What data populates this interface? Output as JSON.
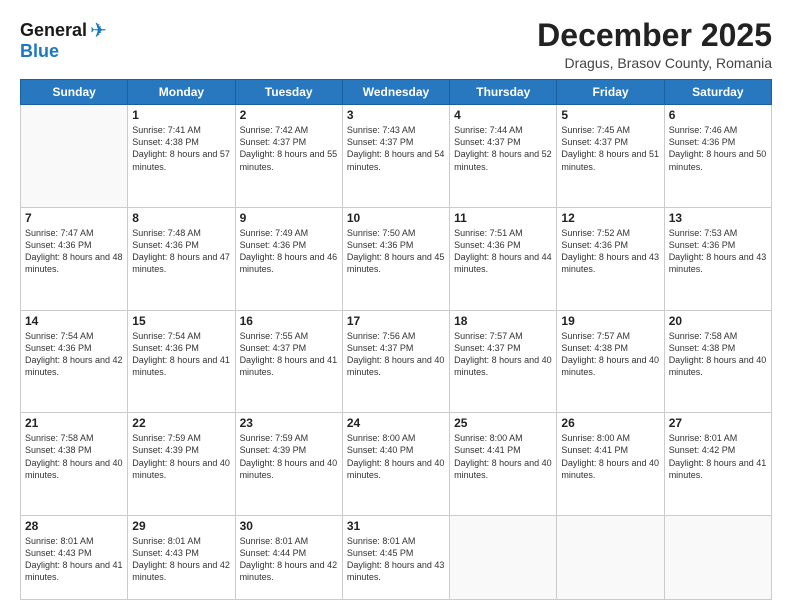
{
  "logo": {
    "line1": "General",
    "line2": "Blue"
  },
  "header": {
    "month": "December 2025",
    "location": "Dragus, Brasov County, Romania"
  },
  "weekdays": [
    "Sunday",
    "Monday",
    "Tuesday",
    "Wednesday",
    "Thursday",
    "Friday",
    "Saturday"
  ],
  "weeks": [
    [
      {
        "day": "",
        "sunrise": "",
        "sunset": "",
        "daylight": ""
      },
      {
        "day": "1",
        "sunrise": "Sunrise: 7:41 AM",
        "sunset": "Sunset: 4:38 PM",
        "daylight": "Daylight: 8 hours and 57 minutes."
      },
      {
        "day": "2",
        "sunrise": "Sunrise: 7:42 AM",
        "sunset": "Sunset: 4:37 PM",
        "daylight": "Daylight: 8 hours and 55 minutes."
      },
      {
        "day": "3",
        "sunrise": "Sunrise: 7:43 AM",
        "sunset": "Sunset: 4:37 PM",
        "daylight": "Daylight: 8 hours and 54 minutes."
      },
      {
        "day": "4",
        "sunrise": "Sunrise: 7:44 AM",
        "sunset": "Sunset: 4:37 PM",
        "daylight": "Daylight: 8 hours and 52 minutes."
      },
      {
        "day": "5",
        "sunrise": "Sunrise: 7:45 AM",
        "sunset": "Sunset: 4:37 PM",
        "daylight": "Daylight: 8 hours and 51 minutes."
      },
      {
        "day": "6",
        "sunrise": "Sunrise: 7:46 AM",
        "sunset": "Sunset: 4:36 PM",
        "daylight": "Daylight: 8 hours and 50 minutes."
      }
    ],
    [
      {
        "day": "7",
        "sunrise": "Sunrise: 7:47 AM",
        "sunset": "Sunset: 4:36 PM",
        "daylight": "Daylight: 8 hours and 48 minutes."
      },
      {
        "day": "8",
        "sunrise": "Sunrise: 7:48 AM",
        "sunset": "Sunset: 4:36 PM",
        "daylight": "Daylight: 8 hours and 47 minutes."
      },
      {
        "day": "9",
        "sunrise": "Sunrise: 7:49 AM",
        "sunset": "Sunset: 4:36 PM",
        "daylight": "Daylight: 8 hours and 46 minutes."
      },
      {
        "day": "10",
        "sunrise": "Sunrise: 7:50 AM",
        "sunset": "Sunset: 4:36 PM",
        "daylight": "Daylight: 8 hours and 45 minutes."
      },
      {
        "day": "11",
        "sunrise": "Sunrise: 7:51 AM",
        "sunset": "Sunset: 4:36 PM",
        "daylight": "Daylight: 8 hours and 44 minutes."
      },
      {
        "day": "12",
        "sunrise": "Sunrise: 7:52 AM",
        "sunset": "Sunset: 4:36 PM",
        "daylight": "Daylight: 8 hours and 43 minutes."
      },
      {
        "day": "13",
        "sunrise": "Sunrise: 7:53 AM",
        "sunset": "Sunset: 4:36 PM",
        "daylight": "Daylight: 8 hours and 43 minutes."
      }
    ],
    [
      {
        "day": "14",
        "sunrise": "Sunrise: 7:54 AM",
        "sunset": "Sunset: 4:36 PM",
        "daylight": "Daylight: 8 hours and 42 minutes."
      },
      {
        "day": "15",
        "sunrise": "Sunrise: 7:54 AM",
        "sunset": "Sunset: 4:36 PM",
        "daylight": "Daylight: 8 hours and 41 minutes."
      },
      {
        "day": "16",
        "sunrise": "Sunrise: 7:55 AM",
        "sunset": "Sunset: 4:37 PM",
        "daylight": "Daylight: 8 hours and 41 minutes."
      },
      {
        "day": "17",
        "sunrise": "Sunrise: 7:56 AM",
        "sunset": "Sunset: 4:37 PM",
        "daylight": "Daylight: 8 hours and 40 minutes."
      },
      {
        "day": "18",
        "sunrise": "Sunrise: 7:57 AM",
        "sunset": "Sunset: 4:37 PM",
        "daylight": "Daylight: 8 hours and 40 minutes."
      },
      {
        "day": "19",
        "sunrise": "Sunrise: 7:57 AM",
        "sunset": "Sunset: 4:38 PM",
        "daylight": "Daylight: 8 hours and 40 minutes."
      },
      {
        "day": "20",
        "sunrise": "Sunrise: 7:58 AM",
        "sunset": "Sunset: 4:38 PM",
        "daylight": "Daylight: 8 hours and 40 minutes."
      }
    ],
    [
      {
        "day": "21",
        "sunrise": "Sunrise: 7:58 AM",
        "sunset": "Sunset: 4:38 PM",
        "daylight": "Daylight: 8 hours and 40 minutes."
      },
      {
        "day": "22",
        "sunrise": "Sunrise: 7:59 AM",
        "sunset": "Sunset: 4:39 PM",
        "daylight": "Daylight: 8 hours and 40 minutes."
      },
      {
        "day": "23",
        "sunrise": "Sunrise: 7:59 AM",
        "sunset": "Sunset: 4:39 PM",
        "daylight": "Daylight: 8 hours and 40 minutes."
      },
      {
        "day": "24",
        "sunrise": "Sunrise: 8:00 AM",
        "sunset": "Sunset: 4:40 PM",
        "daylight": "Daylight: 8 hours and 40 minutes."
      },
      {
        "day": "25",
        "sunrise": "Sunrise: 8:00 AM",
        "sunset": "Sunset: 4:41 PM",
        "daylight": "Daylight: 8 hours and 40 minutes."
      },
      {
        "day": "26",
        "sunrise": "Sunrise: 8:00 AM",
        "sunset": "Sunset: 4:41 PM",
        "daylight": "Daylight: 8 hours and 40 minutes."
      },
      {
        "day": "27",
        "sunrise": "Sunrise: 8:01 AM",
        "sunset": "Sunset: 4:42 PM",
        "daylight": "Daylight: 8 hours and 41 minutes."
      }
    ],
    [
      {
        "day": "28",
        "sunrise": "Sunrise: 8:01 AM",
        "sunset": "Sunset: 4:43 PM",
        "daylight": "Daylight: 8 hours and 41 minutes."
      },
      {
        "day": "29",
        "sunrise": "Sunrise: 8:01 AM",
        "sunset": "Sunset: 4:43 PM",
        "daylight": "Daylight: 8 hours and 42 minutes."
      },
      {
        "day": "30",
        "sunrise": "Sunrise: 8:01 AM",
        "sunset": "Sunset: 4:44 PM",
        "daylight": "Daylight: 8 hours and 42 minutes."
      },
      {
        "day": "31",
        "sunrise": "Sunrise: 8:01 AM",
        "sunset": "Sunset: 4:45 PM",
        "daylight": "Daylight: 8 hours and 43 minutes."
      },
      {
        "day": "",
        "sunrise": "",
        "sunset": "",
        "daylight": ""
      },
      {
        "day": "",
        "sunrise": "",
        "sunset": "",
        "daylight": ""
      },
      {
        "day": "",
        "sunrise": "",
        "sunset": "",
        "daylight": ""
      }
    ]
  ]
}
